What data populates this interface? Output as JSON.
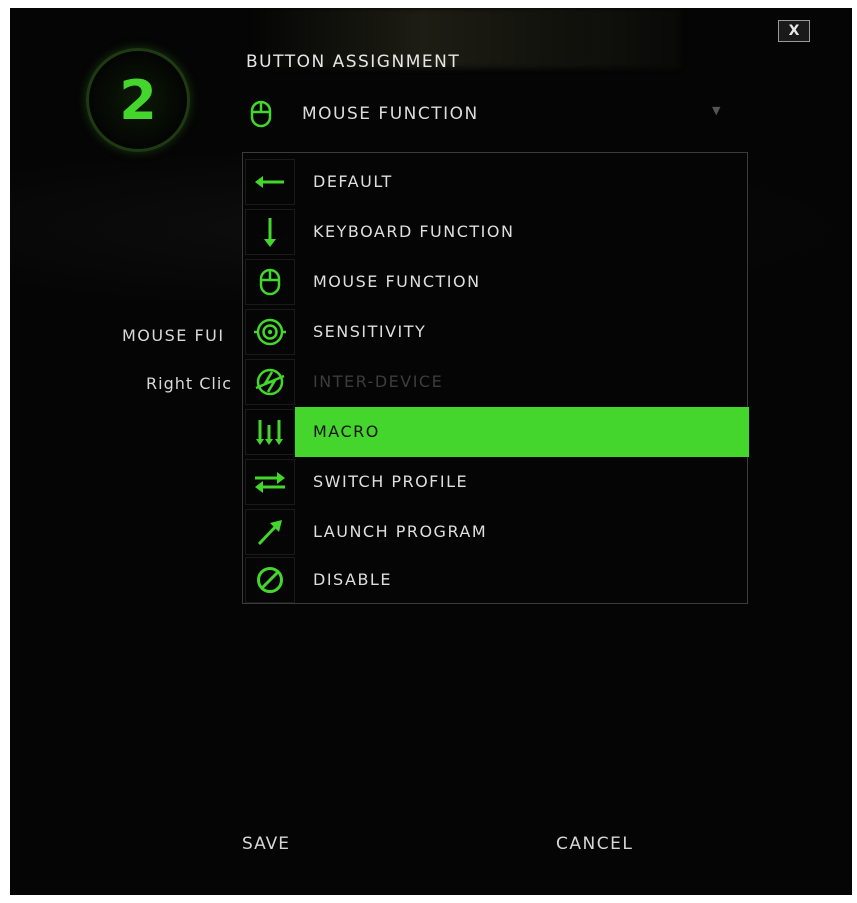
{
  "window": {
    "close_label": "X"
  },
  "badge": {
    "number": "2"
  },
  "assignment": {
    "title": "BUTTON ASSIGNMENT",
    "selected_function": "MOUSE FUNCTION",
    "selected_icon": "mouse-icon"
  },
  "dropdown": {
    "items": [
      {
        "label": "DEFAULT",
        "icon": "default-arrow-icon",
        "state": "normal"
      },
      {
        "label": "KEYBOARD FUNCTION",
        "icon": "keyboard-key-icon",
        "state": "normal"
      },
      {
        "label": "MOUSE FUNCTION",
        "icon": "mouse-icon",
        "state": "normal"
      },
      {
        "label": "SENSITIVITY",
        "icon": "target-icon",
        "state": "normal"
      },
      {
        "label": "INTER-DEVICE",
        "icon": "inter-device-icon",
        "state": "disabled"
      },
      {
        "label": "MACRO",
        "icon": "macro-icon",
        "state": "selected"
      },
      {
        "label": "SWITCH PROFILE",
        "icon": "switch-arrows-icon",
        "state": "normal"
      },
      {
        "label": "LAUNCH PROGRAM",
        "icon": "launch-arrow-icon",
        "state": "normal"
      },
      {
        "label": "DISABLE",
        "icon": "disable-icon",
        "state": "normal"
      }
    ]
  },
  "current_assignment": {
    "label": "MOUSE FUI",
    "value": "Right Clic"
  },
  "footer": {
    "save_label": "SAVE",
    "cancel_label": "CANCEL"
  },
  "colors": {
    "accent": "#44d62c",
    "background": "#050505",
    "text": "#dedede",
    "disabled_text": "#3c3c3c"
  }
}
